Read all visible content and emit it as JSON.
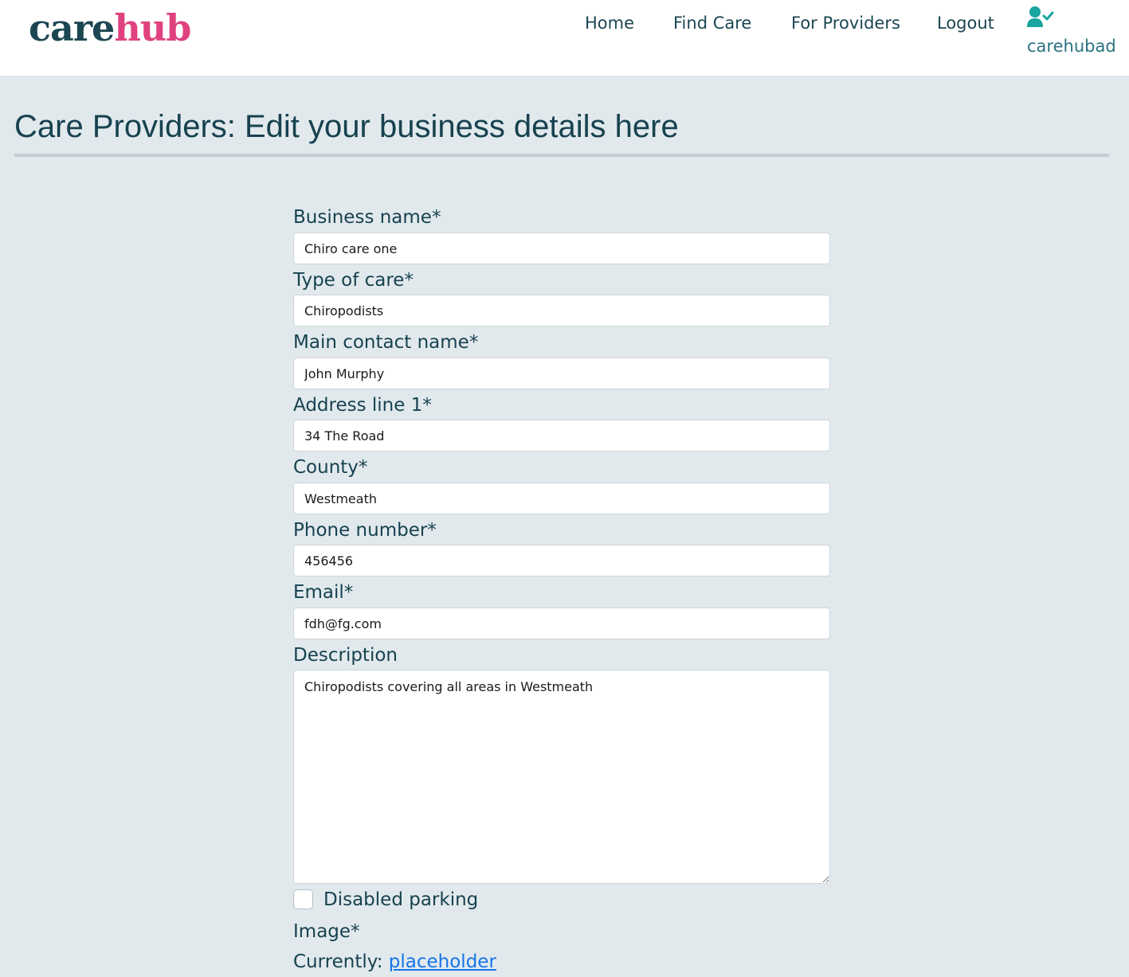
{
  "brand": {
    "part1": "care",
    "part2": "hub"
  },
  "nav": {
    "links": [
      "Home",
      "Find Care",
      "For Providers",
      "Logout"
    ],
    "username": "carehubad",
    "user_icon": "user-check-icon"
  },
  "page": {
    "title": "Care Providers: Edit your business details here"
  },
  "form": {
    "business_name": {
      "label": "Business name*",
      "value": "Chiro care one"
    },
    "type_of_care": {
      "label": "Type of care*",
      "value": "Chiropodists"
    },
    "contact_name": {
      "label": "Main contact name*",
      "value": "John Murphy"
    },
    "address_line1": {
      "label": "Address line 1*",
      "value": "34 The Road"
    },
    "county": {
      "label": "County*",
      "value": "Westmeath"
    },
    "phone": {
      "label": "Phone number*",
      "value": "456456"
    },
    "email": {
      "label": "Email*",
      "value": "fdh@fg.com"
    },
    "description": {
      "label": "Description",
      "value": "Chiropodists covering all areas in Westmeath"
    },
    "disabled_parking": {
      "label": "Disabled parking",
      "checked": false
    },
    "image": {
      "label": "Image*",
      "currently_label": "Currently:",
      "link_text": "placeholder"
    }
  },
  "colors": {
    "brand_dark": "#1c4652",
    "brand_pink": "#e0427f",
    "page_bg": "#e1e9ed",
    "link": "#1574e8",
    "user_icon": "#1aa5a0"
  }
}
